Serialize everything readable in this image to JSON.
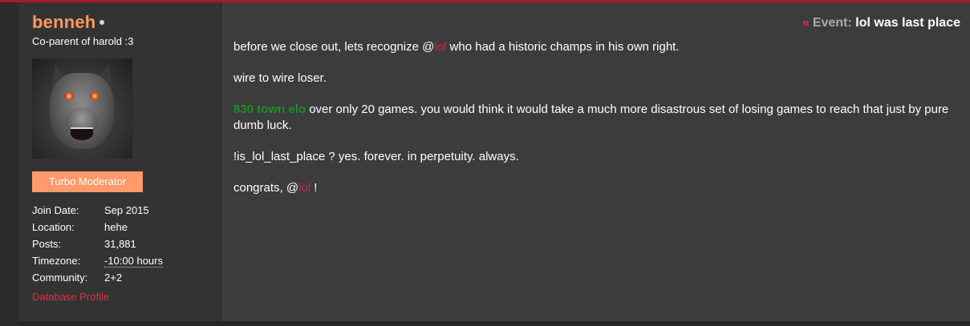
{
  "user": {
    "name": "benneh",
    "title": "Co-parent of harold :3",
    "badge": "Turbo Moderator",
    "details": [
      {
        "key": "Join Date:",
        "value": "Sep 2015"
      },
      {
        "key": "Location:",
        "value": "hehe"
      },
      {
        "key": "Posts:",
        "value": "31,881"
      },
      {
        "key": "Timezone:",
        "value": "-10:00 hours"
      },
      {
        "key": "Community:",
        "value": "2+2"
      }
    ],
    "profile_link": "Database Profile"
  },
  "post": {
    "event_icon": "«",
    "event_label": "Event:",
    "event_title": "lol was last place",
    "line1_a": "before we close out, lets recognize @",
    "line1_mention": "lol",
    "line1_b": " who had a historic champs in his own right.",
    "line2": "wire to wire loser.",
    "line3_highlight": "830 town elo",
    "line3_rest": " over only 20 games. you would think it would take a much more disastrous set of losing games to reach that just by pure dumb luck.",
    "line4": "!is_lol_last_place ? yes. forever. in perpetuity. always.",
    "line5_a": "congrats, @",
    "line5_mention": "lol",
    "line5_b": " !"
  },
  "colors": {
    "username": "#ff9a5e",
    "accent": "#a8182e",
    "mention": "#c12d45",
    "highlight_green": "#1e8f1e",
    "badge_bg": "#ff9a6b"
  }
}
